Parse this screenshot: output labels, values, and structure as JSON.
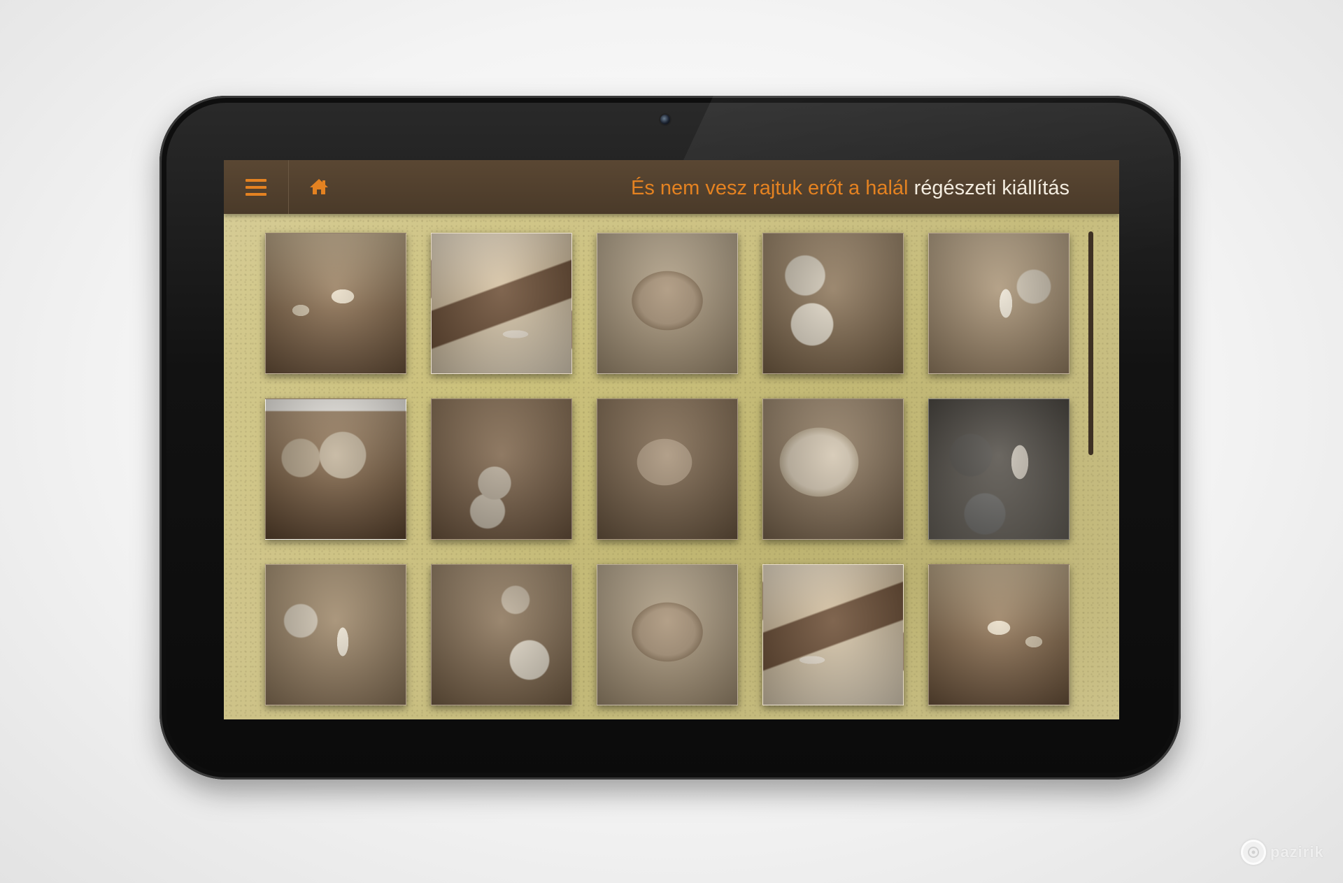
{
  "header": {
    "title_highlight": "És nem vesz rajtuk erőt a halál",
    "title_rest": "régészeti kiállítás",
    "menu_icon": "hamburger-menu-icon",
    "home_icon": "home-icon"
  },
  "colors": {
    "accent": "#e48221",
    "header_bg": "#4f3e2c",
    "title_text": "#f3ecdf"
  },
  "gallery": {
    "rows": 3,
    "columns": 5,
    "items": [
      {
        "photo": "excavation-photo"
      },
      {
        "photo": "excavation-photo"
      },
      {
        "photo": "excavation-photo"
      },
      {
        "photo": "excavation-photo"
      },
      {
        "photo": "excavation-photo"
      },
      {
        "photo": "excavation-photo"
      },
      {
        "photo": "excavation-photo"
      },
      {
        "photo": "excavation-photo"
      },
      {
        "photo": "excavation-photo"
      },
      {
        "photo": "excavation-photo"
      },
      {
        "photo": "excavation-photo"
      },
      {
        "photo": "excavation-photo"
      },
      {
        "photo": "excavation-photo"
      },
      {
        "photo": "excavation-photo"
      },
      {
        "photo": "excavation-photo"
      }
    ]
  },
  "watermark": {
    "text": "pazirik"
  }
}
